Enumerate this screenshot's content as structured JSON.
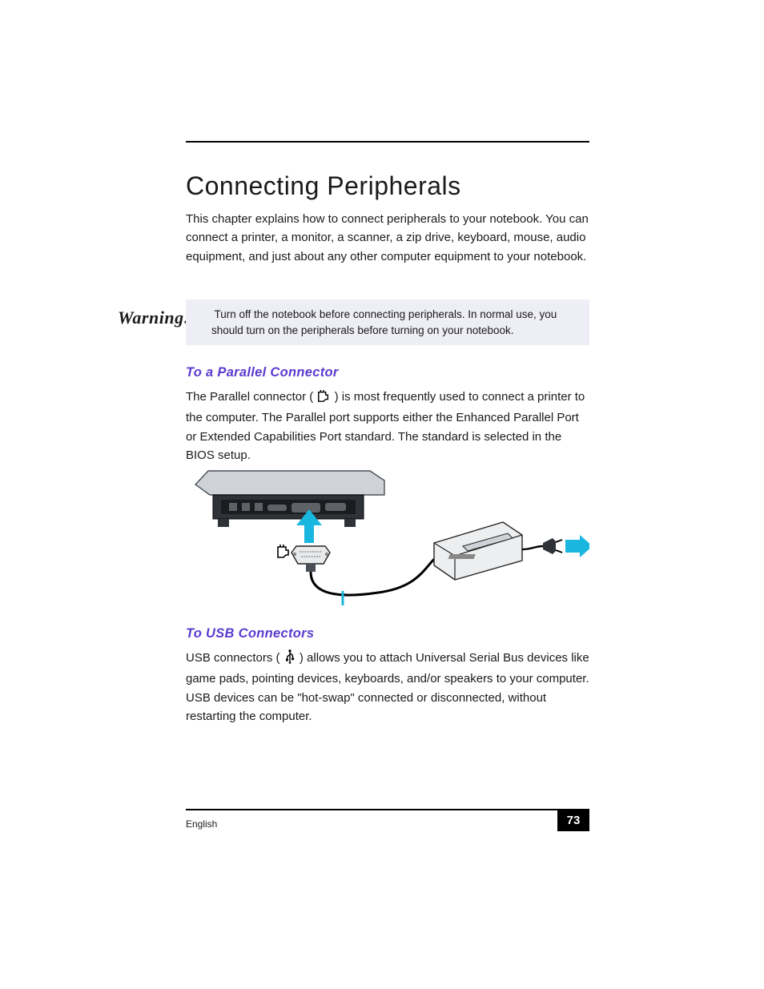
{
  "chapter_title": "Connecting Peripherals",
  "intro_paragraph": "This chapter explains how to connect peripherals to your notebook. You can connect a printer, a monitor, a scanner, a zip drive, keyboard, mouse, audio equipment, and just about any other computer equipment to your notebook.",
  "warning": {
    "label": "Warning:",
    "text": "Turn off the notebook before connecting peripherals. In normal use, you should turn on the peripherals before turning on your notebook."
  },
  "section1": {
    "heading": "To a Parallel Connector",
    "body_before_icon": "The Parallel connector (",
    "body_after_icon": ") is most frequently used to connect a printer to the computer. The Parallel port supports either the Enhanced Parallel Port or Extended Capabilities Port standard. The standard is selected in the BIOS setup."
  },
  "section2": {
    "heading": "To USB Connectors",
    "body_before_icon": "USB connectors (",
    "body_after_icon": ") allows you to attach Universal Serial Bus devices like game pads, pointing devices, keyboards, and/or speakers to your computer. USB devices can be \"hot-swap\" connected or disconnected, without restarting the computer."
  },
  "footer": {
    "left": "English",
    "page_number": "73"
  },
  "icons": {
    "parallel": "parallel-port-icon",
    "usb": "usb-trident-icon"
  },
  "colors": {
    "heading_purple": "#5a3bd1",
    "arrow_cyan": "#19b6e0"
  }
}
